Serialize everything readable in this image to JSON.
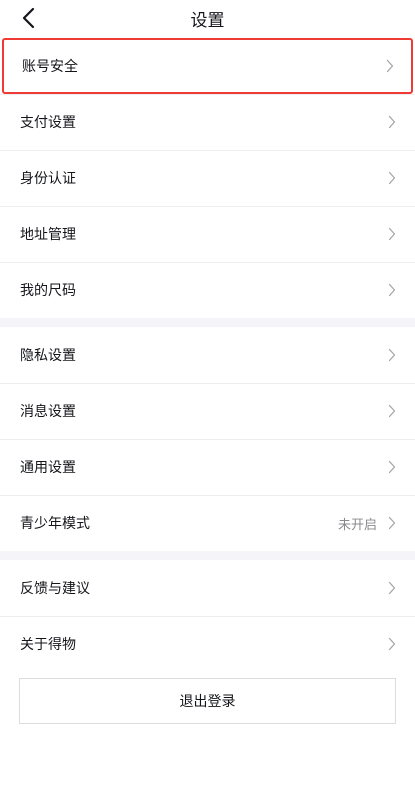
{
  "header": {
    "title": "设置",
    "back_icon": "chevron-left-icon"
  },
  "groups": [
    {
      "items": [
        {
          "label": "账号安全",
          "highlighted": true
        },
        {
          "label": "支付设置"
        },
        {
          "label": "身份认证"
        },
        {
          "label": "地址管理"
        },
        {
          "label": "我的尺码"
        }
      ]
    },
    {
      "items": [
        {
          "label": "隐私设置"
        },
        {
          "label": "消息设置"
        },
        {
          "label": "通用设置"
        },
        {
          "label": "青少年模式",
          "value": "未开启"
        }
      ]
    },
    {
      "items": [
        {
          "label": "反馈与建议"
        },
        {
          "label": "关于得物"
        }
      ]
    }
  ],
  "logout": {
    "label": "退出登录"
  },
  "colors": {
    "highlight_border": "#f03a36",
    "separator": "#eeeef0",
    "group_gap": "#f5f5f9",
    "secondary_text": "#8a8a8f"
  }
}
